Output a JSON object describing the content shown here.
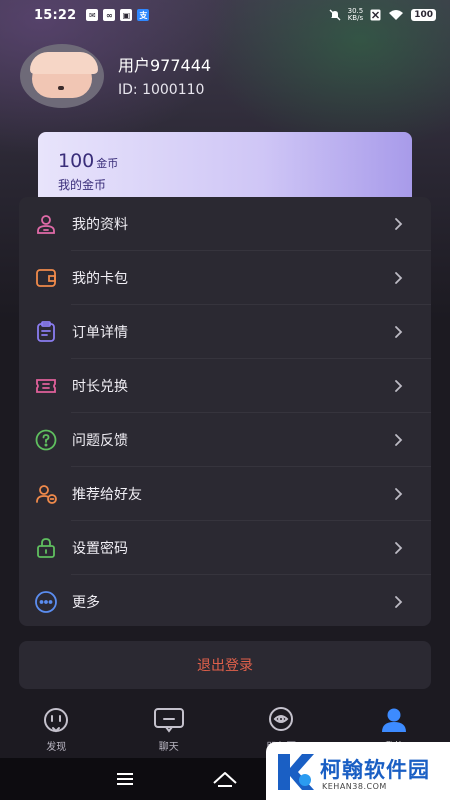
{
  "status_bar": {
    "time": "15:22",
    "net_speed_value": "30.5",
    "net_speed_unit": "KB/s",
    "battery": "100",
    "left_icons": [
      "mail-icon",
      "sync-icon",
      "app-icon",
      "alipay-icon"
    ],
    "right_icons": [
      "mute-icon",
      "no-sim-icon",
      "wifi-icon"
    ]
  },
  "profile": {
    "username": "用户977444",
    "user_id": "ID: 1000110"
  },
  "coins": {
    "amount": "100",
    "unit": "金币",
    "label": "我的金币"
  },
  "menu": [
    {
      "label": "我的资料",
      "icon": "profile-icon",
      "color": "#e06aa8"
    },
    {
      "label": "我的卡包",
      "icon": "wallet-icon",
      "color": "#f08a4b"
    },
    {
      "label": "订单详情",
      "icon": "order-list-icon",
      "color": "#8a7cf0"
    },
    {
      "label": "时长兑换",
      "icon": "ticket-icon",
      "color": "#e0609a"
    },
    {
      "label": "问题反馈",
      "icon": "help-icon",
      "color": "#5fbf5f"
    },
    {
      "label": "推荐给好友",
      "icon": "invite-friend-icon",
      "color": "#f08a4b"
    },
    {
      "label": "设置密码",
      "icon": "lock-icon",
      "color": "#5fbf5f"
    },
    {
      "label": "更多",
      "icon": "more-icon",
      "color": "#5b8df0"
    }
  ],
  "logout_label": "退出登录",
  "tabs": [
    {
      "label": "发现",
      "icon": "discover-icon",
      "active": false
    },
    {
      "label": "聊天",
      "icon": "chat-icon",
      "active": false
    },
    {
      "label": "朋友圈",
      "icon": "moments-icon",
      "active": false
    },
    {
      "label": "我的",
      "icon": "user-icon",
      "active": true
    }
  ],
  "colors": {
    "accent_blue": "#3d8bff",
    "logout_red": "#e0604b",
    "panel_bg": "#2b2932"
  },
  "watermark": {
    "title": "柯翰软件园",
    "url": "KEHAN38.COM"
  }
}
